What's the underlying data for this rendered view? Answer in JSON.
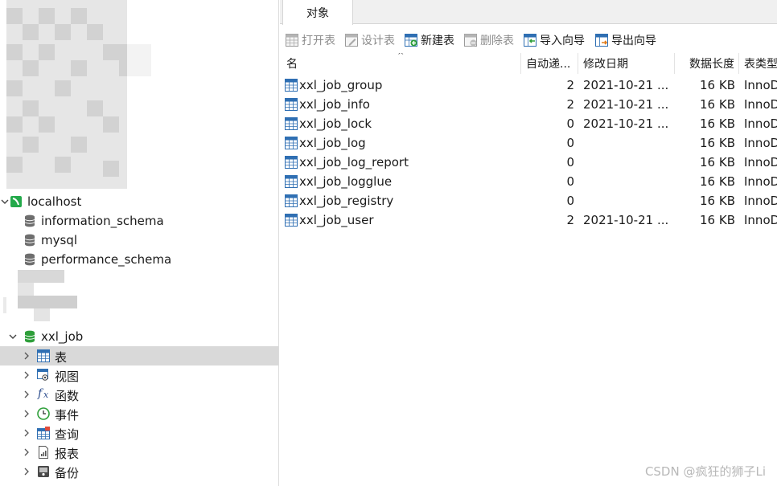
{
  "nav": {
    "connection": {
      "label": "localhost",
      "expanded": true
    },
    "databases": [
      {
        "label": "information_schema"
      },
      {
        "label": "mysql"
      },
      {
        "label": "performance_schema"
      }
    ],
    "active_db": {
      "label": "xxl_job",
      "expanded": true
    },
    "categories": [
      {
        "label": "表",
        "icon": "table-icon",
        "selected": true
      },
      {
        "label": "视图",
        "icon": "view-icon"
      },
      {
        "label": "函数",
        "icon": "function-icon"
      },
      {
        "label": "事件",
        "icon": "event-icon"
      },
      {
        "label": "查询",
        "icon": "query-icon"
      },
      {
        "label": "报表",
        "icon": "report-icon"
      },
      {
        "label": "备份",
        "icon": "backup-icon"
      }
    ]
  },
  "tabs": [
    {
      "label": "对象",
      "active": true
    }
  ],
  "toolbar": {
    "open_table": "打开表",
    "design_table": "设计表",
    "new_table": "新建表",
    "delete_table": "删除表",
    "import_wizard": "导入向导",
    "export_wizard": "导出向导"
  },
  "grid": {
    "columns": [
      "名",
      "自动递...",
      "修改日期",
      "数据长度",
      "表类型"
    ],
    "rows": [
      {
        "name": "xxl_job_group",
        "auto_inc": "2",
        "modified": "2021-10-21 ...",
        "data_length": "16 KB",
        "engine": "InnoDB"
      },
      {
        "name": "xxl_job_info",
        "auto_inc": "2",
        "modified": "2021-10-21 ...",
        "data_length": "16 KB",
        "engine": "InnoDB"
      },
      {
        "name": "xxl_job_lock",
        "auto_inc": "0",
        "modified": "2021-10-21 ...",
        "data_length": "16 KB",
        "engine": "InnoDB"
      },
      {
        "name": "xxl_job_log",
        "auto_inc": "0",
        "modified": "",
        "data_length": "16 KB",
        "engine": "InnoDB"
      },
      {
        "name": "xxl_job_log_report",
        "auto_inc": "0",
        "modified": "",
        "data_length": "16 KB",
        "engine": "InnoDB"
      },
      {
        "name": "xxl_job_logglue",
        "auto_inc": "0",
        "modified": "",
        "data_length": "16 KB",
        "engine": "InnoDB"
      },
      {
        "name": "xxl_job_registry",
        "auto_inc": "0",
        "modified": "",
        "data_length": "16 KB",
        "engine": "InnoDB"
      },
      {
        "name": "xxl_job_user",
        "auto_inc": "2",
        "modified": "2021-10-21 ...",
        "data_length": "16 KB",
        "engine": "InnoDB"
      }
    ]
  },
  "watermark": "CSDN @疯狂的狮子Li",
  "colors": {
    "selected_row": "#d9d9d9",
    "connection_green": "#23a94a",
    "db_green": "#2e9f3a",
    "table_blue": "#2f6fb3"
  }
}
